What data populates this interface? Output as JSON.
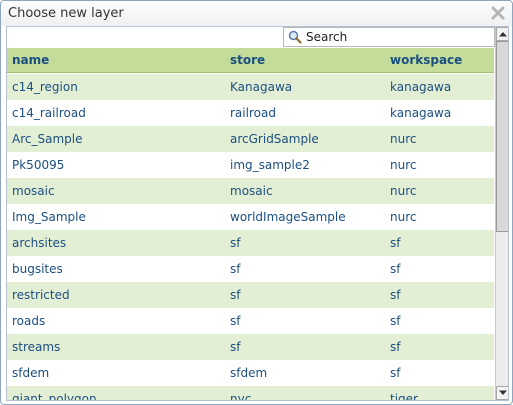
{
  "window": {
    "title": "Choose new layer"
  },
  "search": {
    "label": "Search"
  },
  "table": {
    "columns": [
      "name",
      "store",
      "workspace"
    ],
    "rows": [
      [
        "c14_region",
        "Kanagawa",
        "kanagawa"
      ],
      [
        "c14_railroad",
        "railroad",
        "kanagawa"
      ],
      [
        "Arc_Sample",
        "arcGridSample",
        "nurc"
      ],
      [
        "Pk50095",
        "img_sample2",
        "nurc"
      ],
      [
        "mosaic",
        "mosaic",
        "nurc"
      ],
      [
        "Img_Sample",
        "worldImageSample",
        "nurc"
      ],
      [
        "archsites",
        "sf",
        "sf"
      ],
      [
        "bugsites",
        "sf",
        "sf"
      ],
      [
        "restricted",
        "sf",
        "sf"
      ],
      [
        "roads",
        "sf",
        "sf"
      ],
      [
        "streams",
        "sf",
        "sf"
      ],
      [
        "sfdem",
        "sfdem",
        "sf"
      ],
      [
        "giant_polygon",
        "nyc",
        "tiger"
      ]
    ]
  },
  "colors": {
    "header_bg": "#c3dc9a",
    "row_alt_bg": "#e3efd5",
    "text": "#1c4f80"
  }
}
